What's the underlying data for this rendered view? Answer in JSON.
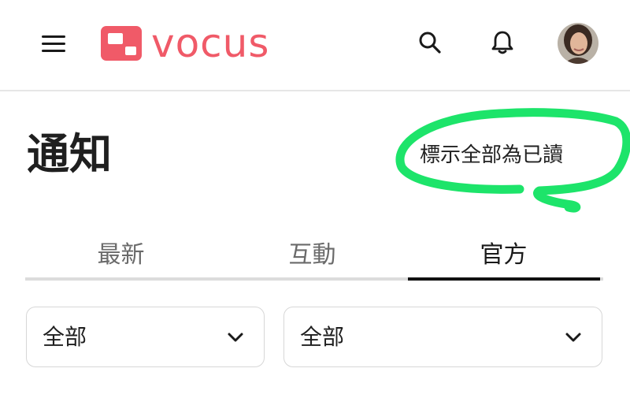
{
  "header": {
    "logo_text": "vocus",
    "brand_color": "#f05a68",
    "icons": [
      "menu-icon",
      "search-icon",
      "bell-icon",
      "avatar"
    ]
  },
  "page": {
    "title": "通知",
    "mark_all_read": "標示全部為已讀",
    "highlight_color": "#1de46a"
  },
  "tabs": [
    {
      "label": "最新",
      "active": false
    },
    {
      "label": "互動",
      "active": false
    },
    {
      "label": "官方",
      "active": true
    }
  ],
  "filters": [
    {
      "selected": "全部"
    },
    {
      "selected": "全部"
    }
  ]
}
